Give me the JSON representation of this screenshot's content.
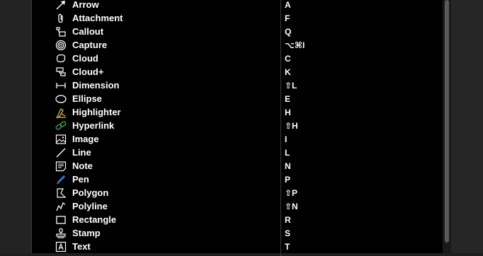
{
  "tools": [
    {
      "label": "Arrow",
      "shortcut": "A",
      "icon": "arrow-icon"
    },
    {
      "label": "Attachment",
      "shortcut": "F",
      "icon": "paperclip-icon"
    },
    {
      "label": "Callout",
      "shortcut": "Q",
      "icon": "callout-icon"
    },
    {
      "label": "Capture",
      "shortcut": "⌥⌘I",
      "icon": "capture-icon"
    },
    {
      "label": "Cloud",
      "shortcut": "C",
      "icon": "cloud-icon"
    },
    {
      "label": "Cloud+",
      "shortcut": "K",
      "icon": "cloud-plus-icon"
    },
    {
      "label": "Dimension",
      "shortcut": "⇧L",
      "icon": "dimension-icon"
    },
    {
      "label": "Ellipse",
      "shortcut": "E",
      "icon": "ellipse-icon"
    },
    {
      "label": "Highlighter",
      "shortcut": "H",
      "icon": "highlighter-icon"
    },
    {
      "label": "Hyperlink",
      "shortcut": "⇧H",
      "icon": "hyperlink-icon"
    },
    {
      "label": "Image",
      "shortcut": "I",
      "icon": "image-icon"
    },
    {
      "label": "Line",
      "shortcut": "L",
      "icon": "line-icon"
    },
    {
      "label": "Note",
      "shortcut": "N",
      "icon": "note-icon"
    },
    {
      "label": "Pen",
      "shortcut": "P",
      "icon": "pen-icon"
    },
    {
      "label": "Polygon",
      "shortcut": "⇧P",
      "icon": "polygon-icon"
    },
    {
      "label": "Polyline",
      "shortcut": "⇧N",
      "icon": "polyline-icon"
    },
    {
      "label": "Rectangle",
      "shortcut": "R",
      "icon": "rectangle-icon"
    },
    {
      "label": "Stamp",
      "shortcut": "S",
      "icon": "stamp-icon"
    },
    {
      "label": "Text",
      "shortcut": "T",
      "icon": "text-icon"
    }
  ],
  "colors": {
    "highlighter": "#c9a64a",
    "hyperlink": "#3aa844",
    "pen": "#2a7fd4"
  }
}
